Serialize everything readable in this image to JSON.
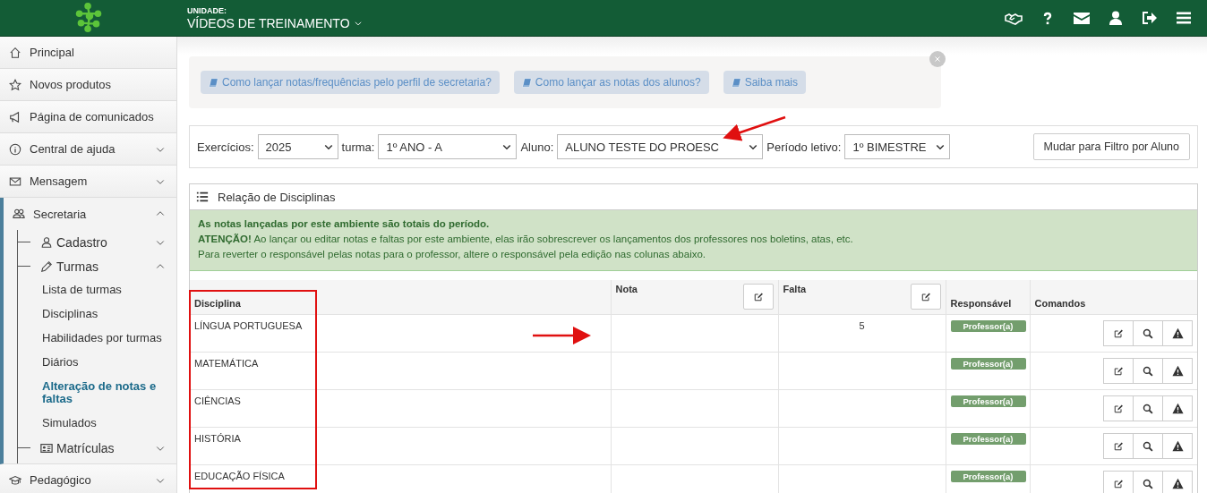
{
  "header": {
    "unit_label": "UNIDADE:",
    "unit_name": "VÍDEOS DE TREINAMENTO"
  },
  "sidebar": {
    "items": [
      {
        "kind": "home",
        "label": "Principal"
      },
      {
        "kind": "star",
        "label": "Novos produtos"
      },
      {
        "kind": "megaphone",
        "label": "Página de comunicados"
      },
      {
        "kind": "info",
        "label": "Central de ajuda",
        "expanded": false
      },
      {
        "kind": "mail",
        "label": "Mensagem",
        "expanded": false
      },
      {
        "kind": "users",
        "label": "Secretaria",
        "expanded": true,
        "children": [
          {
            "kind": "user",
            "label": "Cadastro",
            "expanded": false
          },
          {
            "kind": "pencil",
            "label": "Turmas",
            "expanded": true,
            "children": [
              {
                "label": "Lista de turmas",
                "selected": false
              },
              {
                "label": "Disciplinas",
                "selected": false
              },
              {
                "label": "Habilidades por turmas",
                "selected": false
              },
              {
                "label": "Diários",
                "selected": false
              },
              {
                "label": "Alteração de notas e faltas",
                "selected": true
              },
              {
                "label": "Simulados",
                "selected": false
              }
            ]
          },
          {
            "kind": "idcard",
            "label": "Matrículas",
            "expanded": false
          }
        ]
      },
      {
        "kind": "cap",
        "label": "Pedagógico",
        "expanded": false
      }
    ]
  },
  "help_links": [
    "Como lançar notas/frequências pelo perfil de secretaria?",
    "Como lançar as notas dos alunos?",
    "Saiba mais"
  ],
  "filters": [
    {
      "label": "Exercícios:",
      "value": "2025"
    },
    {
      "label": "turma:",
      "value": "1º ANO - A"
    },
    {
      "label": "Aluno:",
      "value": "ALUNO TESTE DO PROESC"
    },
    {
      "label": "Período letivo:",
      "value": "1º BIMESTRE"
    }
  ],
  "filter_button": "Mudar para Filtro por Aluno",
  "table": {
    "title": "Relação de Disciplinas",
    "notices": [
      "As notas lançadas por este ambiente são totais do período.",
      "**ATENÇÃO!** Ao lançar ou editar notas e faltas por este ambiente, elas irão sobrescrever os lançamentos dos professores nos boletins, atas, etc.",
      "Para reverter o responsável pelas notas para o professor, altere o responsável pela edição nas colunas abaixo."
    ],
    "columns": [
      "Disciplina",
      "Nota",
      "Falta",
      "Responsável",
      "Comandos"
    ],
    "rows": [
      {
        "disciplina": "LÍNGUA PORTUGUESA",
        "nota": "",
        "falta": "5",
        "responsavel": "Professor(a)"
      },
      {
        "disciplina": "MATEMÁTICA",
        "nota": "",
        "falta": "",
        "responsavel": "Professor(a)"
      },
      {
        "disciplina": "CIÊNCIAS",
        "nota": "",
        "falta": "",
        "responsavel": "Professor(a)"
      },
      {
        "disciplina": "HISTÓRIA",
        "nota": "",
        "falta": "",
        "responsavel": "Professor(a)"
      },
      {
        "disciplina": "EDUCAÇÃO FÍSICA",
        "nota": "",
        "falta": "",
        "responsavel": "Professor(a)"
      }
    ]
  }
}
